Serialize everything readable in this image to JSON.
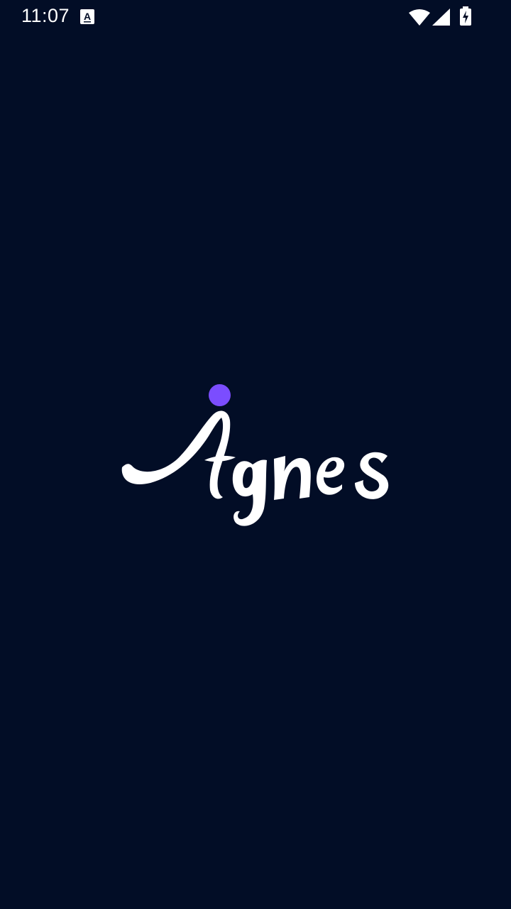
{
  "status_bar": {
    "time": "11:07",
    "notification_icon": "a-notification-icon",
    "wifi_icon": "wifi-icon",
    "signal_icon": "cell-signal-icon",
    "battery_icon": "battery-charging-icon"
  },
  "splash": {
    "brand_name": "Agnes",
    "logo_icon": "agnes-logo",
    "dot_color": "#7b4dff"
  },
  "colors": {
    "background": "#020d26",
    "logo_text": "#ffffff"
  }
}
